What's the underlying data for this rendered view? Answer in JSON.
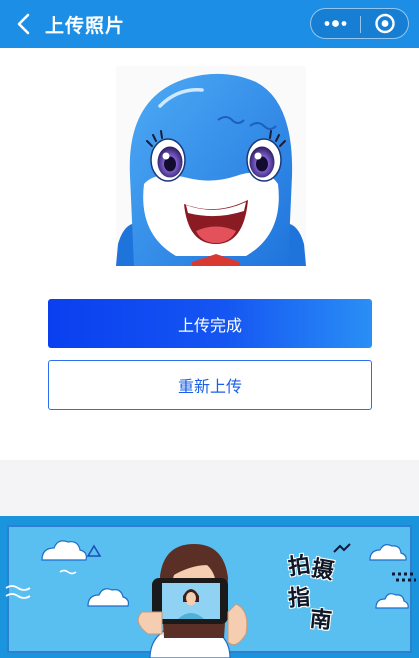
{
  "header": {
    "title": "上传照片",
    "back_icon": "chevron-left-icon",
    "more_icon": "more-dots-icon",
    "close_icon": "target-circle-icon",
    "bar_color": "#1c8ee6"
  },
  "photo": {
    "subject": "blue dolphin cartoon mascot"
  },
  "actions": {
    "primary_label": "上传完成",
    "secondary_label": "重新上传",
    "primary_color": "#1556f2"
  },
  "banner": {
    "guide_chars": [
      "拍",
      "摄",
      "指",
      "南"
    ]
  }
}
